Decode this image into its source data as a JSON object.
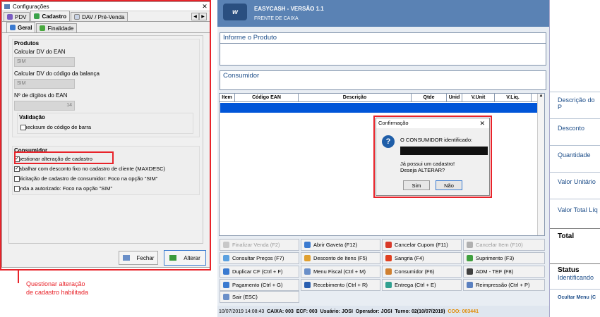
{
  "config": {
    "window_title": "Configurações",
    "tabs": [
      "PDV",
      "Cadastro",
      "DAV / Pré-Venda"
    ],
    "subtabs": [
      "Geral",
      "Finalidade"
    ],
    "produtos": {
      "title": "Produtos",
      "ean_label": "Calcular DV do EAN",
      "ean_value": "SIM",
      "balanca_label": "Calcular DV do código da balança",
      "balanca_value": "SIM",
      "digitos_label": "Nº de dígitos do EAN",
      "digitos_value": "14"
    },
    "validacao": {
      "title": "Validação",
      "checksum_label": "Checksum do código de barra"
    },
    "consumidor": {
      "title": "Consumidor",
      "options": [
        "Questionar alteração de cadastro",
        "Trabalhar com desconto fixo no cadastro de cliente (MAXDESC)",
        "Solicitação de cadastro de consumidor: Foco na opção \"SIM\"",
        "Venda a autorizado: Foco na opção \"SIM\""
      ],
      "checked": [
        true,
        true,
        false,
        false
      ]
    },
    "buttons": {
      "fechar": "Fechar",
      "alterar": "Alterar"
    }
  },
  "annotation": {
    "line1": "Questionar alteração",
    "line2": "de cadastro habilitada",
    "color": "#e8232a"
  },
  "easycash": {
    "title": "EASYCASH - VERSÃO 1.1",
    "subtitle": "FRENTE DE CAIXA",
    "logo": "w",
    "informe_produto": "Informe o Produto",
    "consumidor": "Consumidor",
    "grid_headers": [
      "Item",
      "Código EAN",
      "Descrição",
      "Qtde",
      "Unid",
      "V.Unit",
      "V.Liq."
    ],
    "right_panel": {
      "descricao": "Descrição do P",
      "desconto": "Desconto",
      "quantidade": "Quantidade",
      "valor_unitario": "Valor Unitário",
      "valor_total": "Valor Total Líq",
      "total": "Total",
      "status": "Status",
      "identificando": "Identificando",
      "ocultar": "Ocultar Menu (C"
    },
    "function_buttons": [
      [
        "Finalizar Venda (F2)",
        "Abrir Gaveta (F12)",
        "Cancelar Cupom (F11)",
        "Cancelar Item (F10)"
      ],
      [
        "Consultar Preços (F7)",
        "Desconto de Itens (F5)",
        "Sangria (F4)",
        "Suprimento (F3)"
      ],
      [
        "Duplicar CF (Ctrl + F)",
        "Menu Fiscal (Ctrl + M)",
        "Consumidor (F6)",
        "ADM - TEF (F8)"
      ],
      [
        "Pagamento (Ctrl + G)",
        "Recebimento (Ctrl + R)",
        "Entrega (Ctrl + E)",
        "Reimpressão (Ctrl + P)"
      ],
      [
        "Sair (ESC)"
      ]
    ],
    "status_bar": {
      "datetime": "10/07/2019 14:08:43",
      "caixa": "CAIXA: 003",
      "ecf": "ECF: 003",
      "usuario": "Usuário: JOSI",
      "operador": "Operador: JOSI",
      "turno": "Turno: 02(10/07/2019)",
      "coo": "COO: 003441"
    }
  },
  "dialog": {
    "title": "Confirmação",
    "line1": "O CONSUMIDOR identificado:",
    "line2": "Já possui um cadastro!",
    "line3": "Deseja ALTERAR?",
    "sim": "Sim",
    "nao": "Não"
  }
}
